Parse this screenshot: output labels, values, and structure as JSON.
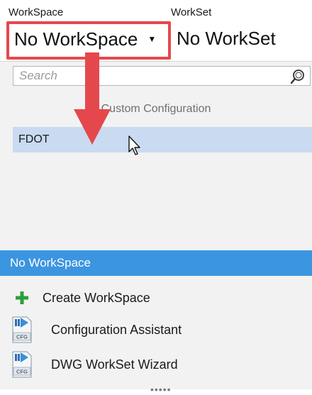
{
  "header": {
    "workspace_label": "WorkSpace",
    "workset_label": "WorkSet",
    "workspace_value": "No WorkSpace",
    "workset_value": "No WorkSet"
  },
  "dropdown": {
    "search_placeholder": "Search",
    "group_header": "Custom Configuration",
    "items": [
      {
        "label": "FDOT",
        "state": "hovered"
      }
    ],
    "selected": "No WorkSpace"
  },
  "actions": {
    "create": "Create WorkSpace",
    "config_assistant": "Configuration Assistant",
    "workset_wizard": "DWG WorkSet Wizard",
    "cfg_badge": "CFG"
  },
  "colors": {
    "annotation": "#e5484c",
    "selected_bar": "#3c95e0",
    "hover_row": "#c9daf1",
    "add_icon": "#2e9e3b"
  }
}
